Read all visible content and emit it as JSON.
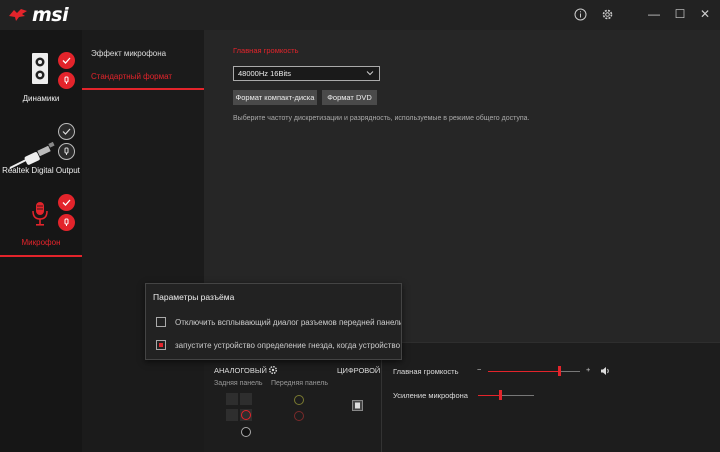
{
  "brand": {
    "name": "msi"
  },
  "titlebar": {
    "info_icon": "info-icon",
    "settings_icon": "gear-icon",
    "minimize": "—",
    "maximize": "☐",
    "close": "✕"
  },
  "sidebar": {
    "devices": [
      {
        "label": "Динамики",
        "icon": "speaker-icon",
        "active": false
      },
      {
        "label": "Realtek Digital Output",
        "icon": "optical-cable-icon",
        "active": false
      },
      {
        "label": "Микрофон",
        "icon": "microphone-icon",
        "active": true
      }
    ]
  },
  "submenu": {
    "items": [
      {
        "label": "Эффект микрофона",
        "active": false
      },
      {
        "label": "Стандартный формат",
        "active": true
      }
    ]
  },
  "main": {
    "section_title": "Главная громкость",
    "format_select": {
      "value": "48000Hz 16Bits"
    },
    "cd_button": "Формат компакт-диска",
    "dvd_button": "Формат DVD",
    "description": "Выберите частоту дискретизации и разрядность, используемые в режиме общего доступа."
  },
  "bottom": {
    "analog_label": "АНАЛОГОВЫЙ",
    "digital_label": "ЦИФРОВОЙ",
    "rear_panel": "Задняя панель",
    "front_panel": "Передняя панель",
    "master_volume_label": "Главная громкость",
    "mic_boost_label": "Усиление микрофона",
    "minus": "−",
    "plus": "+",
    "master_volume_level": 0.78,
    "mic_boost_level": 0.4
  },
  "popup": {
    "title": "Параметры разъёма",
    "options": [
      {
        "label": "Отключить всплывающий диалог разъемов передней панели",
        "checked": false
      },
      {
        "label": "запустите устройство определение гнезда, когда  устройство подключено",
        "checked": true
      }
    ]
  },
  "colors": {
    "accent": "#e3242b",
    "background": "#1f1f1f"
  }
}
